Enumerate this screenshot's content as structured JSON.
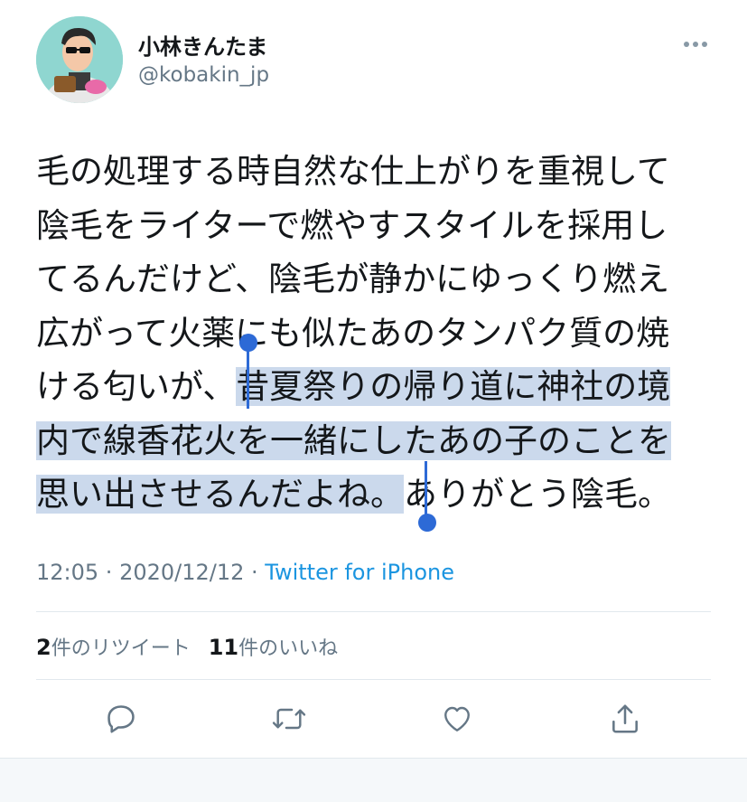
{
  "author": {
    "display_name": "小林きんたま",
    "handle": "@kobakin_jp"
  },
  "tweet": {
    "lines": [
      {
        "plain": "毛の処理する時自然な仕上がりを重視して",
        "selected": "",
        "after": ""
      },
      {
        "plain": "陰毛をライターで燃やすスタイルを採用し",
        "selected": "",
        "after": ""
      },
      {
        "plain": "てるんだけど、陰毛が静かにゆっくり燃え",
        "selected": "",
        "after": ""
      },
      {
        "plain": "広がって火薬にも似たあのタンパク質の焼",
        "selected": "",
        "after": ""
      },
      {
        "plain": "ける匂いが、",
        "selected": "昔夏祭りの帰り道に神社の境",
        "after": ""
      },
      {
        "plain": "",
        "selected": "内で線香花火を一緒にしたあの子のことを",
        "after": ""
      },
      {
        "plain": "",
        "selected": "思い出させるんだよね。",
        "after": "ありがとう陰毛。"
      }
    ]
  },
  "meta": {
    "time": "12:05",
    "sep1": " · ",
    "date": "2020/12/12",
    "sep2": " · ",
    "source": "Twitter for iPhone"
  },
  "stats": {
    "retweets_count": "2",
    "retweets_label": "件のリツイート",
    "likes_count": "11",
    "likes_label": "件のいいね"
  },
  "icons": {
    "more": "more-dots-icon",
    "reply": "reply-icon",
    "retweet": "retweet-icon",
    "like": "heart-icon",
    "share": "share-icon"
  },
  "colors": {
    "accent": "#1b95e0",
    "selection": "#cbd9ec",
    "selection_handle": "#2d6ad6",
    "muted": "#657786"
  }
}
